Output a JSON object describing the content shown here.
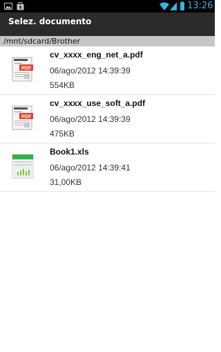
{
  "status_bar": {
    "time": "13:26",
    "time_color": "#33b5e5",
    "icons": [
      "image-icon",
      "bag-icon",
      "wifi-icon",
      "signal-icon",
      "battery-icon"
    ]
  },
  "title_bar": {
    "title": "Selez. documento"
  },
  "path_bar": {
    "path": "/mnt/sdcard/Brother"
  },
  "files": [
    {
      "name": "cv_xxxx_eng_net_a.pdf",
      "date": "06/ago/2012 14:39:39",
      "size": "554KB",
      "icon": "pdf-file-icon"
    },
    {
      "name": "cv_xxxx_use_soft_a.pdf",
      "date": "06/ago/2012 14:39:39",
      "size": "475KB",
      "icon": "pdf-file-icon"
    },
    {
      "name": "Book1.xls",
      "date": "06/ago/2012 14:39:41",
      "size": "31,00KB",
      "icon": "xls-file-icon"
    }
  ],
  "colors": {
    "status_bar_bg": "#000000",
    "title_bar_bg": "#2b2b2b",
    "path_bar_bg": "#c6c6c6",
    "pdf_badge": "#e5412d",
    "xls_green": "#2fb34a"
  }
}
